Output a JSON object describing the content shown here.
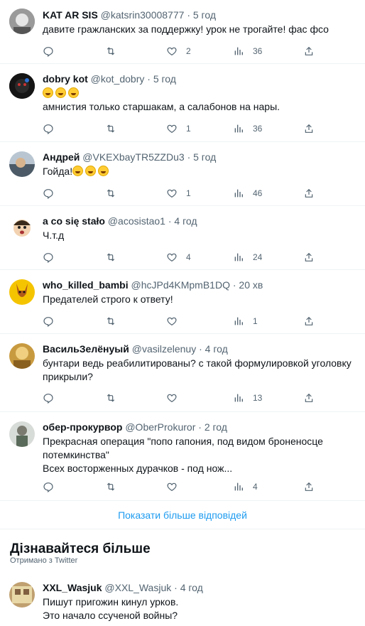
{
  "tweets": [
    {
      "name": "KAT AR SIS",
      "handle": "@katsrin30008777",
      "time": "· 5 год",
      "lines": [
        "давите гражланских за поддержку! урок не трогайте! фас фсо"
      ],
      "replies": "",
      "retweets": "",
      "likes": "2",
      "views": "36",
      "avatar_color": "#8a8a8a"
    },
    {
      "name": "dobry kot",
      "handle": "@kot_dobry",
      "time": "· 5 год",
      "emoji_count": 3,
      "lines": [
        "амнистия только старшакам, а салабонов на нары."
      ],
      "replies": "",
      "retweets": "",
      "likes": "1",
      "views": "36",
      "avatar_color": "#1a1a1a"
    },
    {
      "name": "Андрей",
      "handle": "@VKEXbayTR5ZZDu3",
      "time": "· 5 год",
      "lines": [
        "Гойда!"
      ],
      "emoji_after_first": 3,
      "replies": "",
      "retweets": "",
      "likes": "1",
      "views": "46",
      "avatar_color": "#5a6b7a"
    },
    {
      "name": "a co się stało",
      "handle": "@acosistao1",
      "time": "· 4 год",
      "lines": [
        "Ч.т.д"
      ],
      "replies": "",
      "retweets": "",
      "likes": "4",
      "views": "24",
      "avatar_color": "#e8c9a8"
    },
    {
      "name": "who_killed_bambi",
      "handle": "@hcJPd4KMpmB1DQ",
      "time": "· 20 хв",
      "lines": [
        "Предателей строго к ответу!"
      ],
      "replies": "",
      "retweets": "",
      "likes": "",
      "views": "1",
      "avatar_color": "#f2c200"
    },
    {
      "name": "ВасильЗелёнуый",
      "handle": "@vasilzelenuy",
      "time": "· 4 год",
      "lines": [
        "бунтари ведь реабилитированы? с такой формулировкой уголовку",
        "прикрыли?"
      ],
      "replies": "",
      "retweets": "",
      "likes": "",
      "views": "13",
      "avatar_color": "#c8a050"
    },
    {
      "name": "обер-прокурвор",
      "handle": "@OberProkuror",
      "time": "· 2 год",
      "lines": [
        "Прекрасная операция \"попо гапония, под видом броненосце",
        "потемкинства\"",
        "Всех восторженных дурачков - под нож..."
      ],
      "replies": "",
      "retweets": "",
      "likes": "",
      "views": "4",
      "avatar_color": "#8a9a8a"
    }
  ],
  "show_more": "Показати більше відповідей",
  "section": {
    "title": "Дізнавайтеся більше",
    "subtitle": "Отримано з Twitter"
  },
  "last_tweet": {
    "name": "XXL_Wasjuk",
    "handle": "@XXL_Wasjuk",
    "time": "· 4 год",
    "lines": [
      "Пишут пригожин кинул урков.",
      "Это начало ссученой войны?"
    ],
    "avatar_color": "#b8a070"
  }
}
